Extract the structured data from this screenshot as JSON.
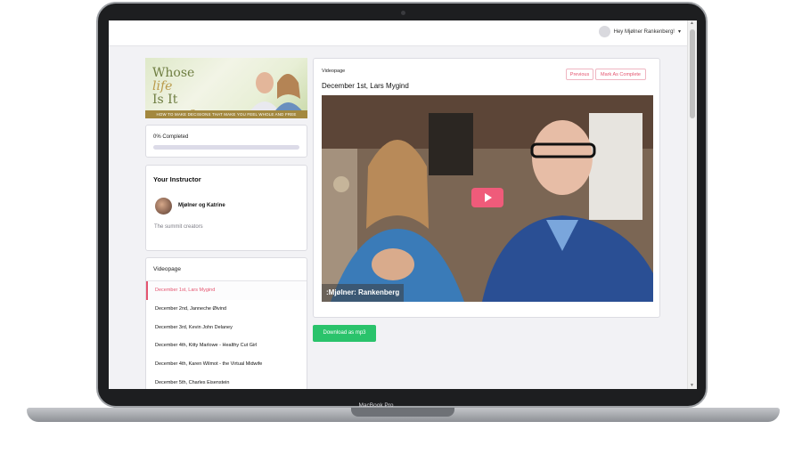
{
  "device": {
    "label": "MacBook Pro"
  },
  "header": {
    "user_greeting": "Hey Mjølner Rankenberg!"
  },
  "banner": {
    "title_lines": [
      "Whose",
      "life",
      "Is It",
      "anyway?"
    ],
    "tagline": "HOW TO MAKE DECISIONS THAT MAKE YOU FEEL WHOLE AND FREE"
  },
  "progress": {
    "label": "0% Completed",
    "fraction": 0
  },
  "instructor": {
    "heading": "Your Instructor",
    "name": "Mjølner og Katrine",
    "description": "The summit creators"
  },
  "lessons": {
    "heading": "Videopage",
    "items": [
      "December 1st, Lars Mygind",
      "December 2nd, Janneche Øivind",
      "December 3rd, Kevin John Delaney",
      "December 4th, Kitty Marlowe - Healthy Cut Girl",
      "December 4th, Karen Wilmot - the Virtual Midwife",
      "December 5th, Charles Eisenstein"
    ],
    "active_index": 0
  },
  "video_panel": {
    "label": "Videopage",
    "title": "December 1st, Lars Mygind",
    "previous_label": "Previous",
    "complete_label": "Mark As Complete",
    "caption": ":Mjølner: Rankenberg"
  },
  "download": {
    "label": "Download as mp3"
  },
  "colors": {
    "accent": "#ef5b7a",
    "download": "#2ac36b",
    "banner_green": "#6f7e42",
    "banner_gold": "#a3883f"
  }
}
